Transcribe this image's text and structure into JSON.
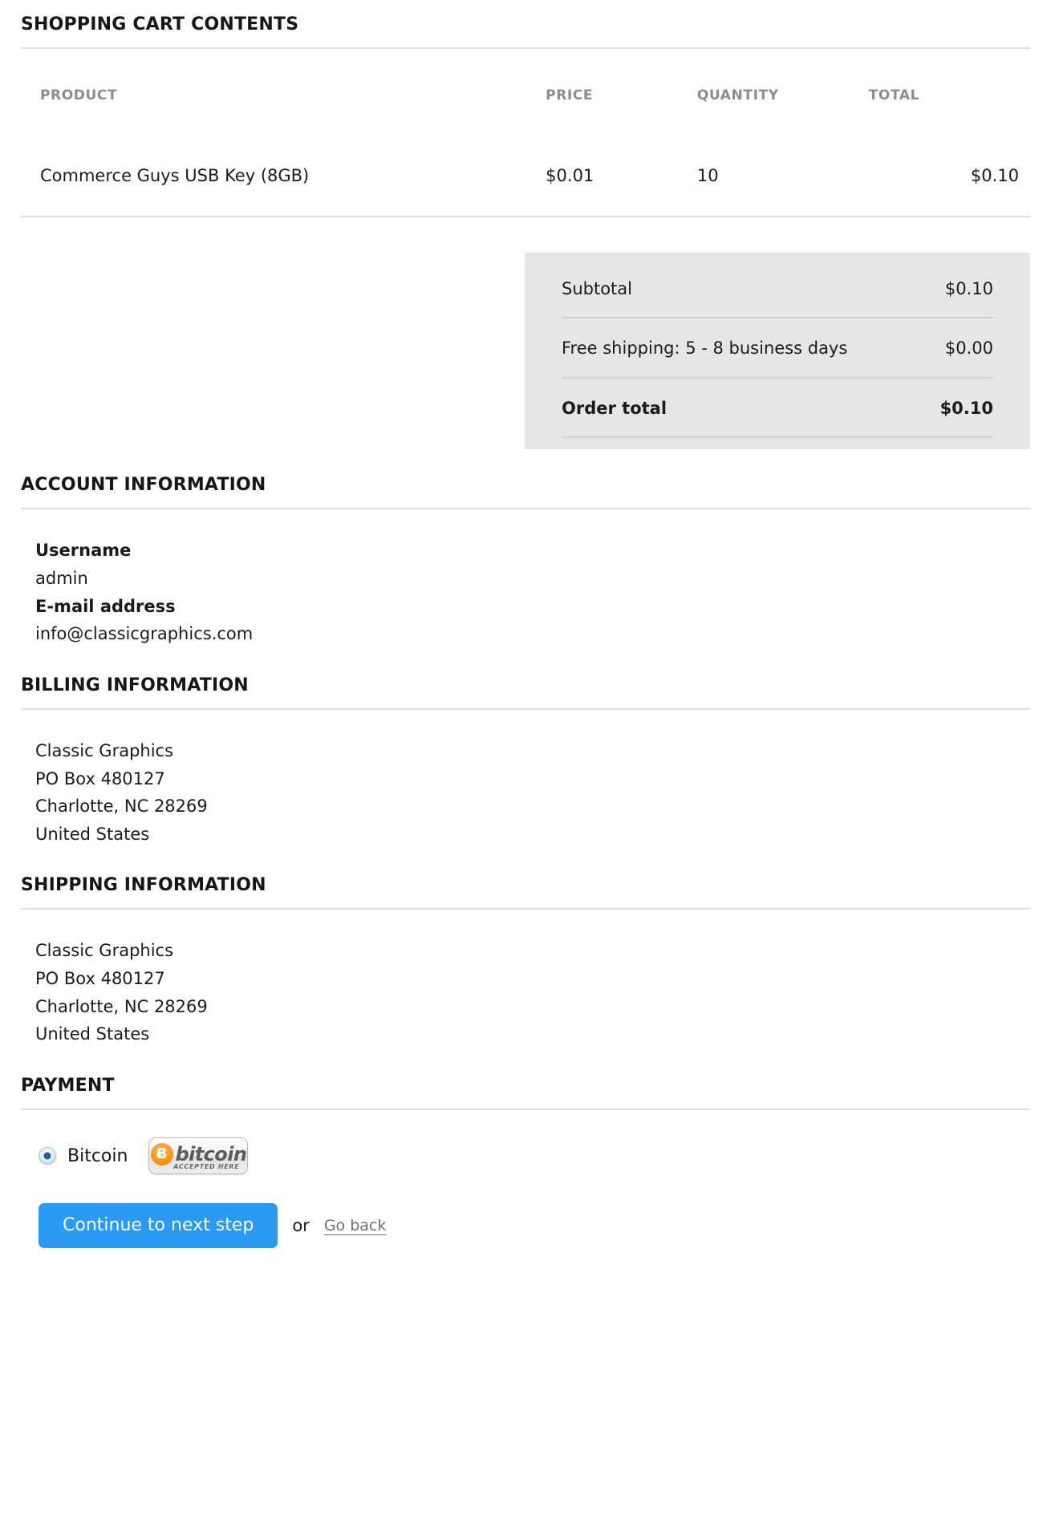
{
  "cart": {
    "section_title": "SHOPPING CART CONTENTS",
    "columns": [
      "PRODUCT",
      "PRICE",
      "QUANTITY",
      "TOTAL"
    ],
    "rows": [
      {
        "product": "Commerce Guys USB Key (8GB)",
        "price": "$0.01",
        "quantity": "10",
        "total": "$0.10"
      }
    ]
  },
  "summary": {
    "rows": [
      {
        "label": "Subtotal",
        "value": "$0.10"
      },
      {
        "label": "Free shipping: 5 - 8 business days",
        "value": "$0.00"
      },
      {
        "label": "Order total",
        "value": "$0.10"
      }
    ],
    "background": "#e6e6e6"
  },
  "account": {
    "section_title": "ACCOUNT INFORMATION",
    "username_label": "Username",
    "username_value": "admin",
    "email_label": "E-mail address",
    "email_value": "info@classicgraphics.com"
  },
  "billing": {
    "section_title": "BILLING INFORMATION",
    "lines": [
      "Classic Graphics",
      "PO Box 480127",
      "Charlotte, NC 28269",
      "United States"
    ]
  },
  "shipping": {
    "section_title": "SHIPPING INFORMATION",
    "lines": [
      "Classic Graphics",
      "PO Box 480127",
      "Charlotte, NC 28269",
      "United States"
    ]
  },
  "payment": {
    "section_title": "PAYMENT",
    "method_label": "Bitcoin",
    "method_selected": true,
    "badge": {
      "symbol": "Ƀ",
      "word": "bitcoin",
      "tagline": "ACCEPTED HERE",
      "accent": "#f7931a"
    }
  },
  "actions": {
    "primary_label": "Continue to next step",
    "or_label": "or",
    "back_label": "Go back",
    "primary_color": "#2b9af3"
  }
}
